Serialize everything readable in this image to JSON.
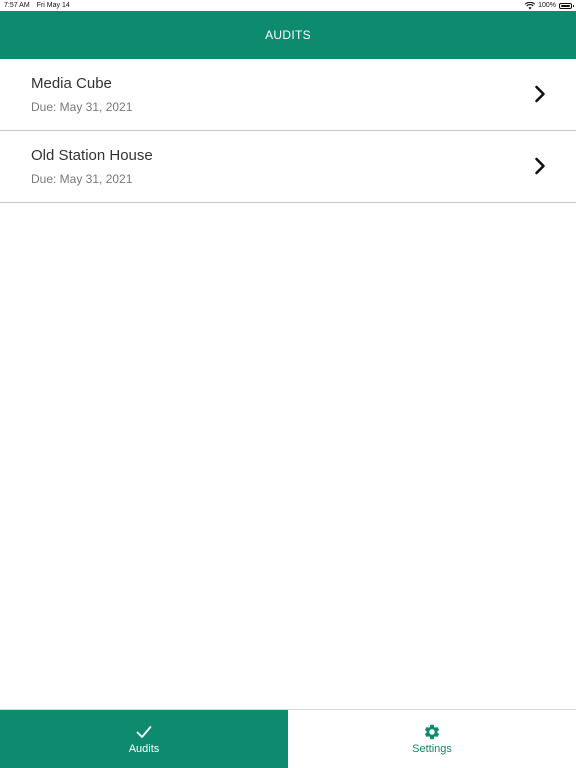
{
  "status_bar": {
    "time": "7:57 AM",
    "date": "Fri May 14",
    "battery": "100%"
  },
  "header": {
    "title": "AUDITS"
  },
  "audits": [
    {
      "name": "Media Cube",
      "due": "Due: May 31, 2021"
    },
    {
      "name": "Old Station House",
      "due": "Due: May 31, 2021"
    }
  ],
  "tabs": [
    {
      "label": "Audits",
      "icon": "checkmark-icon",
      "active": true
    },
    {
      "label": "Settings",
      "icon": "gear-icon",
      "active": false
    }
  ],
  "colors": {
    "accent": "#0e8a6e",
    "divider": "#c7c7c7",
    "title_text": "#333333",
    "secondary_text": "#7a7a7a"
  }
}
